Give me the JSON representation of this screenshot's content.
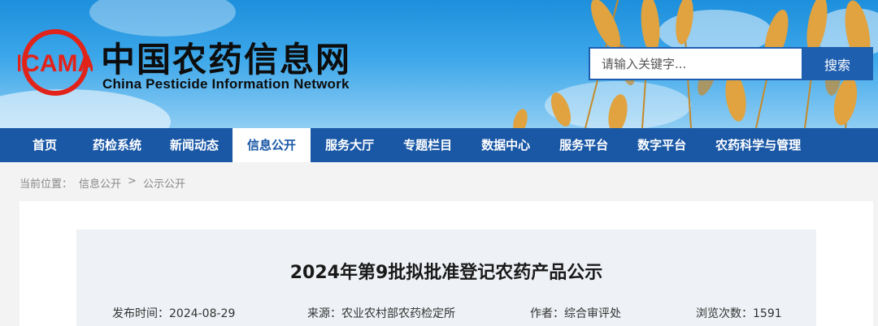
{
  "header": {
    "site_title_cn": "中国农药信息网",
    "site_title_en": "China Pesticide Information Network",
    "logo_text": "ICAMA",
    "search_placeholder": "请输入关键字...",
    "search_button": "搜索"
  },
  "nav": {
    "items": [
      {
        "label": "首页"
      },
      {
        "label": "药检系统"
      },
      {
        "label": "新闻动态"
      },
      {
        "label": "信息公开",
        "active": true
      },
      {
        "label": "服务大厅"
      },
      {
        "label": "专题栏目"
      },
      {
        "label": "数据中心"
      },
      {
        "label": "服务平台"
      },
      {
        "label": "数字平台"
      },
      {
        "label": "农药科学与管理"
      }
    ]
  },
  "breadcrumb": {
    "prefix": "当前位置：",
    "items": [
      "信息公开",
      "公示公开"
    ],
    "separator": ">"
  },
  "article": {
    "title": "2024年第9批拟批准登记农药产品公示",
    "publish_label": "发布时间：",
    "publish_date": "2024-08-29",
    "source_label": "来源：",
    "source": "农业农村部农药检定所",
    "author_label": "作者：",
    "author": "综合审评处",
    "views_label": "浏览次数：",
    "views": "1591"
  },
  "colors": {
    "nav_bg": "#1a58a6",
    "search_button_bg": "#1f5fb0",
    "logo_red": "#e2231a"
  }
}
